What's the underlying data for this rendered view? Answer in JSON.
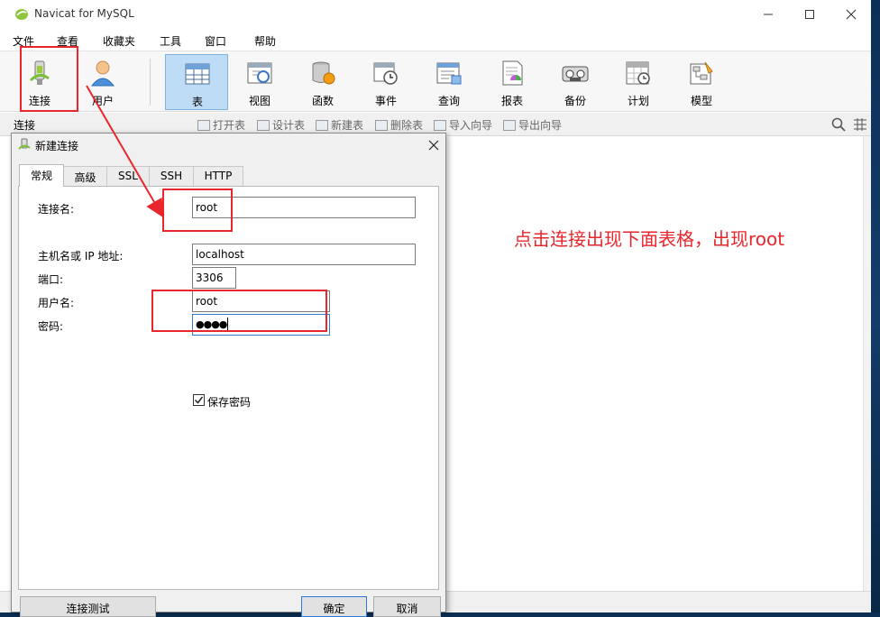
{
  "window": {
    "title": "Navicat for MySQL"
  },
  "menu": [
    "文件",
    "查看",
    "收藏夹",
    "工具",
    "窗口",
    "帮助"
  ],
  "toolbar": {
    "buttons": [
      {
        "label": "连接",
        "icon": "connection-plug-icon"
      },
      {
        "label": "用户",
        "icon": "user-icon"
      },
      {
        "label": "表",
        "icon": "table-icon",
        "active": true
      },
      {
        "label": "视图",
        "icon": "view-icon"
      },
      {
        "label": "函数",
        "icon": "function-icon"
      },
      {
        "label": "事件",
        "icon": "event-clock-icon"
      },
      {
        "label": "查询",
        "icon": "query-icon"
      },
      {
        "label": "报表",
        "icon": "report-icon"
      },
      {
        "label": "备份",
        "icon": "backup-icon"
      },
      {
        "label": "计划",
        "icon": "schedule-icon"
      },
      {
        "label": "模型",
        "icon": "model-icon"
      }
    ]
  },
  "subbar": {
    "label": "连接",
    "items": [
      "打开表",
      "设计表",
      "新建表",
      "删除表",
      "导入向导",
      "导出向导"
    ]
  },
  "annotation": "点击连接出现下面表格，出现root",
  "dialog": {
    "title": "新建连接",
    "tabs": [
      "常规",
      "高级",
      "SSL",
      "SSH",
      "HTTP"
    ],
    "active_tab": "常规",
    "fields": {
      "connection_name": {
        "label": "连接名:",
        "value": "root"
      },
      "host": {
        "label": "主机名或 IP 地址:",
        "value": "localhost"
      },
      "port": {
        "label": "端口:",
        "value": "3306"
      },
      "username": {
        "label": "用户名:",
        "value": "root"
      },
      "password": {
        "label": "密码:",
        "value": "●●●●"
      }
    },
    "save_password": {
      "label": "保存密码",
      "checked": true
    },
    "buttons": {
      "test": "连接测试",
      "ok": "确定",
      "cancel": "取消"
    }
  },
  "colors": {
    "accent": "#2b79d4",
    "annotation_red": "#e8262b",
    "active_tab_bg": "#bfdcf6"
  }
}
